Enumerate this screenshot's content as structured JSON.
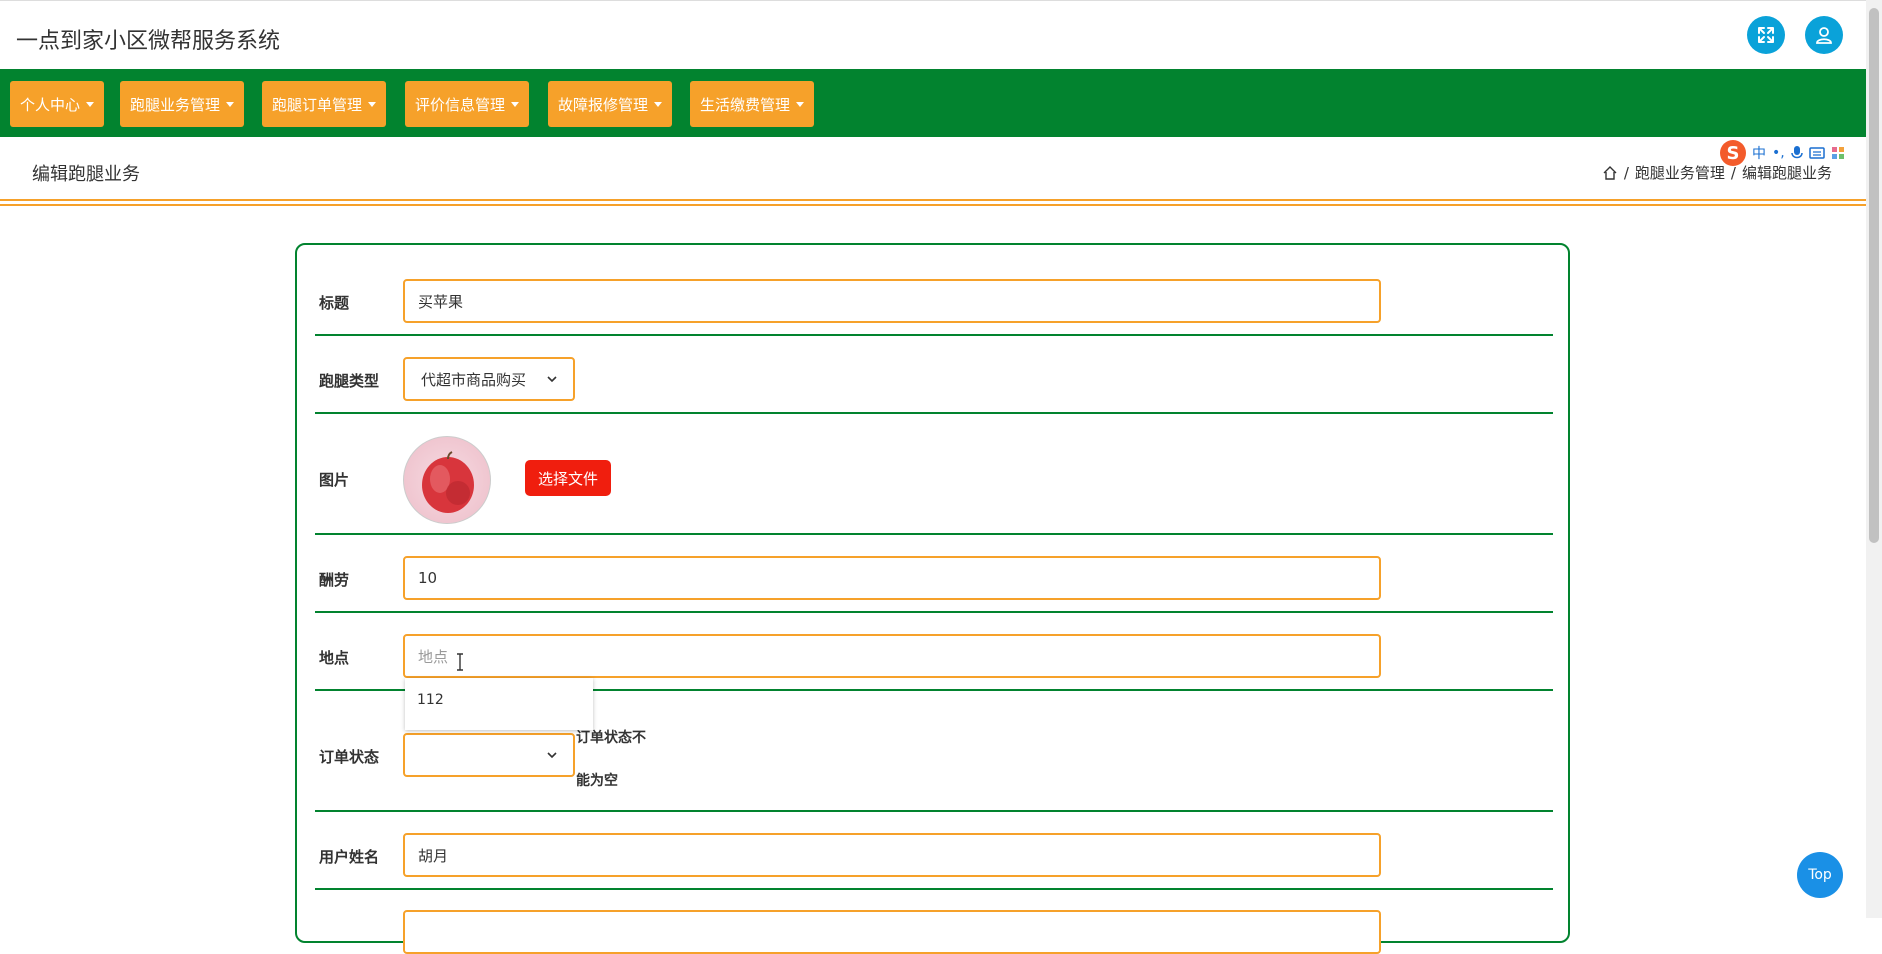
{
  "header": {
    "app_title": "一点到家小区微帮服务系统",
    "fullscreen_icon": "fullscreen-icon",
    "user_icon": "user-icon"
  },
  "nav": {
    "items": [
      {
        "label": "个人中心"
      },
      {
        "label": "跑腿业务管理"
      },
      {
        "label": "跑腿订单管理"
      },
      {
        "label": "评价信息管理"
      },
      {
        "label": "故障报修管理"
      },
      {
        "label": "生活缴费管理"
      }
    ]
  },
  "page": {
    "title": "编辑跑腿业务",
    "breadcrumb": [
      "跑腿业务管理",
      "编辑跑腿业务"
    ],
    "breadcrumb_sep": "/"
  },
  "ime": {
    "logo": "S",
    "mode": "中",
    "punct": "•,"
  },
  "form": {
    "title_label": "标题",
    "title_value": "买苹果",
    "type_label": "跑腿类型",
    "type_value": "代超市商品购买",
    "image_label": "图片",
    "file_button": "选择文件",
    "reward_label": "酬劳",
    "reward_value": "10",
    "location_label": "地点",
    "location_placeholder": "地点",
    "autocomplete_option": "112",
    "status_label": "订单状态",
    "status_value": "",
    "status_error_line1": "订单状态不",
    "status_error_line2": "能为空",
    "username_label": "用户姓名",
    "username_value": "胡月"
  },
  "top_button": "Top",
  "colors": {
    "nav_bg": "#02832f",
    "accent": "#f6a12a",
    "header_btn": "#0aa2d9",
    "file_btn": "#f01e0e",
    "top_btn": "#1a90e6"
  }
}
